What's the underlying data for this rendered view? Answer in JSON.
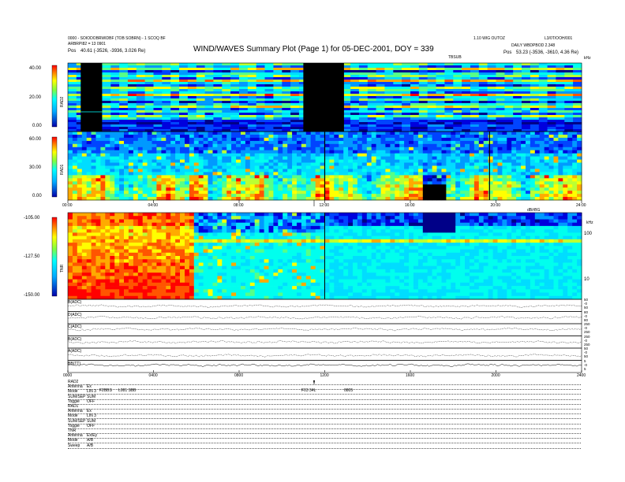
{
  "header": {
    "title": "WIND/WAVES Summary Plot (Page 1) for 05-DEC-2001, DOY = 339",
    "left_line1": "0000 - SOIODOBRWIDBF (TOB SOBRN) - 1 SCOQ BF",
    "left_line2": "ARBRPI82 = 13 0901",
    "left_pos_label": "Pos",
    "left_pos_value": "40.61 (-3526, -3936, 3.026 Re)",
    "right_line1": "1.10 WIG OUTOZ",
    "right_line1b": "L3/0T/OOH/001",
    "right_line2": "DAILY WBDPBOD 2.348",
    "right_pos_label": "Pos",
    "right_pos_value": "53.23 (-3536, -3610, 4.36 Re)",
    "tbsub_label": "TBSUB",
    "corner_label": "kHz"
  },
  "panels": {
    "rad2": {
      "label": "RAD2",
      "ticks": [
        "40.00",
        "20.00",
        "0.00"
      ]
    },
    "rad1": {
      "label": "RAD1",
      "ticks": [
        "60.00",
        "30.00",
        "0.00"
      ]
    },
    "tnr": {
      "label": "TNR",
      "ticks": [
        "-105.00",
        "-127.50",
        "-150.00"
      ],
      "right_ticks": [
        "100",
        "10"
      ],
      "right_label": "kHz"
    }
  },
  "time_axis": {
    "labels": [
      "00:00",
      "04:00",
      "08:00",
      "12:00",
      "16:00",
      "20:00",
      "24:00"
    ],
    "unit": "dB/rBG"
  },
  "line_panels": [
    {
      "label": "B(ADC)",
      "ticks": [
        "50",
        "-0",
        "50"
      ]
    },
    {
      "label": "D(ADC)",
      "ticks": [
        "80",
        "-0",
        "80"
      ]
    },
    {
      "label": "C(ADC)",
      "ticks": [
        "250",
        "-0",
        "250"
      ]
    },
    {
      "label": "B(ADC)",
      "ticks": [
        "250",
        "-0",
        "250"
      ]
    },
    {
      "label": "A(ADC)",
      "ticks": [
        "50",
        "-0",
        "50"
      ]
    },
    {
      "label": "BB(TT)",
      "ticks": [
        "5",
        "-0",
        "5"
      ]
    }
  ],
  "bottom_axis": {
    "labels": [
      "0000",
      "0400",
      "0800",
      "1200",
      "1600",
      "2000",
      "2400"
    ]
  },
  "table": {
    "rows": [
      {
        "k": "RAD2",
        "v": ""
      },
      {
        "k": "Antenna",
        "v": "Ex"
      },
      {
        "k": "Mode",
        "v": "LIN 3"
      },
      {
        "k": "SUM/SEP",
        "v": "SUM"
      },
      {
        "k": "Toggle",
        "v": "OFF"
      },
      {
        "k": "RAD1",
        "v": ""
      },
      {
        "k": "Antenna",
        "v": "Ex"
      },
      {
        "k": "Mode",
        "v": "LIN 3"
      },
      {
        "k": "SUM/SEP",
        "v": "SUM"
      },
      {
        "k": "Toggle",
        "v": "OFF"
      },
      {
        "k": "TNR",
        "v": ""
      },
      {
        "k": "Antenna",
        "v": "Ex/Ey"
      },
      {
        "k": "Mode",
        "v": "A/B"
      },
      {
        "k": "Sweep",
        "v": "A/B"
      }
    ],
    "notes": [
      "F2BBS",
      "L081 SBB",
      "F03 34L",
      "0805"
    ]
  },
  "chart_data": [
    {
      "type": "heatmap",
      "name": "RAD2",
      "x_unit": "hours UT",
      "xlim": [
        0,
        24
      ],
      "ylabel": "RAD2",
      "ylim": [
        0,
        40
      ],
      "color_ticks": [
        "40.00",
        "20.00",
        "0.00"
      ],
      "data_gaps_hours": [
        [
          0.6,
          1.6
        ],
        [
          11.0,
          12.9
        ]
      ]
    },
    {
      "type": "heatmap",
      "name": "RAD1",
      "x_unit": "hours UT",
      "xlim": [
        0,
        24
      ],
      "ylabel": "RAD1",
      "ylim": [
        0,
        60
      ],
      "color_ticks": [
        "60.00",
        "30.00",
        "0.00"
      ]
    },
    {
      "type": "heatmap",
      "name": "TNR",
      "x_unit": "hours UT",
      "xlim": [
        0,
        24
      ],
      "ylabel": "TNR",
      "color_ticks": [
        "-105.00",
        "-127.50",
        "-150.00"
      ],
      "right_axis_ticks": [
        "100",
        "10"
      ],
      "right_axis_unit": "kHz"
    },
    {
      "type": "line",
      "name": "time series",
      "x_unit": "hours UT",
      "xlim": [
        0,
        24
      ],
      "series": [
        {
          "label": "B(ADC)",
          "base_level": 0.45
        },
        {
          "label": "D(ADC)",
          "base_level": 0.5
        },
        {
          "label": "C(ADC)",
          "base_level": 0.55
        },
        {
          "label": "B(ADC)",
          "base_level": 0.5
        },
        {
          "label": "A(ADC)",
          "base_level": 0.4
        },
        {
          "label": "BB(TT)",
          "base_level": 0.6
        }
      ]
    }
  ]
}
